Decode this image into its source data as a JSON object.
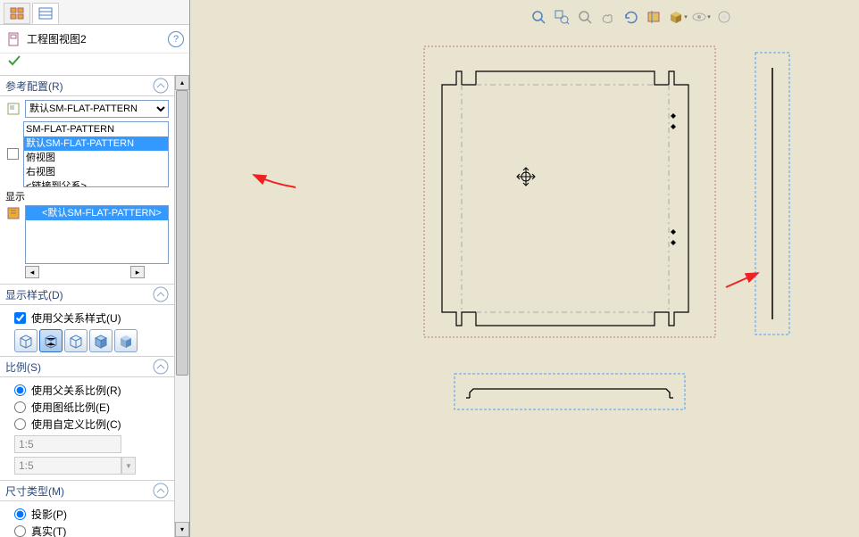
{
  "title_icon": "page-icon",
  "page_title": "工程图视图2",
  "help_icon": "?",
  "sections": {
    "config": {
      "title": "参考配置(R)"
    },
    "display_style": {
      "title": "显示样式(D)",
      "use_parent": "使用父关系样式(U)"
    },
    "scale": {
      "title": "比例(S)",
      "parent_ratio": "使用父关系比例(R)",
      "sheet_ratio": "使用图纸比例(E)",
      "custom_ratio": "使用自定义比例(C)",
      "value1": "1:5",
      "value2": "1:5"
    },
    "dim_type": {
      "title": "尺寸类型(M)",
      "projection": "投影(P)",
      "true": "真实(T)"
    }
  },
  "config_dropdown": {
    "selected": "默认SM-FLAT-PATTERN",
    "items": [
      "SM-FLAT-PATTERN",
      "默认SM-FLAT-PATTERN",
      "俯视图",
      "右视图",
      "<链接到父系>"
    ]
  },
  "display_label": "显示",
  "tree_item": "<默认SM-FLAT-PATTERN>",
  "style_icons": [
    "wireframe",
    "hidden-gray",
    "hidden-removed",
    "shaded-edges",
    "shaded"
  ]
}
